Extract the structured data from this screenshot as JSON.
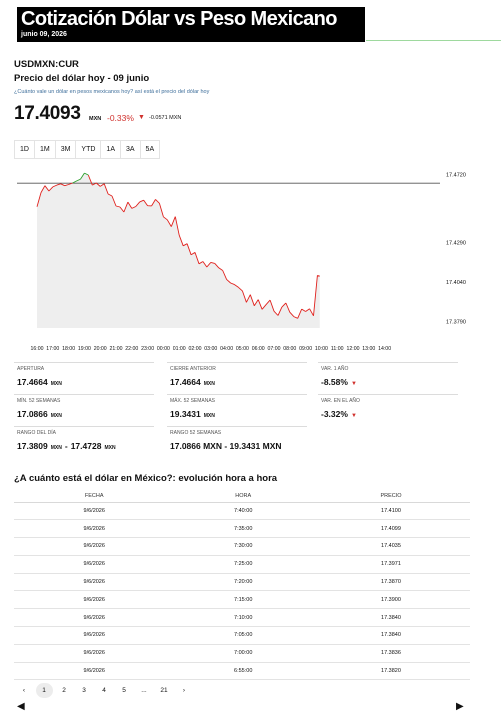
{
  "header": {
    "title": "Cotización Dólar vs Peso Mexicano",
    "date": "junio 09, 2026"
  },
  "quote": {
    "ticker": "USDMXN:CUR",
    "subtitle": "Precio del dólar hoy - 09 junio",
    "question": "¿Cuánto vale un dólar en pesos mexicanos hoy? así está el precio del dólar hoy",
    "price": "17.4093",
    "unit": "MXN",
    "change_pct": "-0.33%",
    "change_arrow": "▼",
    "change_abs": "-0.0571 MXN"
  },
  "range_tabs": [
    {
      "label": "1D",
      "active": true
    },
    {
      "label": "1M",
      "active": false
    },
    {
      "label": "3M",
      "active": false
    },
    {
      "label": "YTD",
      "active": false
    },
    {
      "label": "1A",
      "active": false
    },
    {
      "label": "3A",
      "active": false
    },
    {
      "label": "5A",
      "active": false
    }
  ],
  "colors": {
    "up": "#2ca02c",
    "down": "#e0211d",
    "reference_line": "#555555",
    "area_fill": "#eeeeee"
  },
  "chart_data": {
    "type": "line",
    "title": "",
    "xlabel": "",
    "ylabel": "",
    "x_ticks": [
      "16:00",
      "17:00",
      "18:00",
      "19:00",
      "20:00",
      "21:00",
      "22:00",
      "23:00",
      "00:00",
      "01:00",
      "02:00",
      "03:00",
      "04:00",
      "05:00",
      "06:00",
      "07:00",
      "08:00",
      "09:00",
      "10:00",
      "11:00",
      "12:00",
      "13:00",
      "14:00"
    ],
    "y_ticks": [
      17.472,
      17.429,
      17.404,
      17.379
    ],
    "ylim": [
      17.375,
      17.476
    ],
    "y_axis_side": "right",
    "reference_value": 17.4664,
    "reference_label": "Cierre anterior",
    "series": [
      {
        "hours_after_1600": [
          0,
          0.25,
          0.5,
          0.75,
          1,
          1.25,
          1.5,
          1.75,
          2,
          2.25,
          2.5,
          2.75,
          3,
          3.25,
          3.5,
          3.75,
          4,
          4.25,
          4.5,
          4.75,
          5,
          5.25,
          5.5,
          5.75,
          6,
          6.25,
          6.5,
          6.75,
          7,
          7.25,
          7.5,
          7.75,
          8,
          8.25,
          8.5,
          8.75,
          9,
          9.25,
          9.5,
          9.75,
          10,
          10.25,
          10.5,
          10.75,
          11,
          11.25,
          11.5,
          11.75,
          12,
          12.25,
          12.5,
          12.75,
          13,
          13.25,
          13.5,
          13.75,
          14,
          14.25,
          14.5,
          14.75,
          15,
          15.25,
          15.5,
          15.75,
          16,
          16.25,
          16.5,
          16.75,
          17,
          17.25,
          17.5,
          17.75,
          17.9
        ],
        "values": [
          17.4515,
          17.4605,
          17.4648,
          17.4615,
          17.4641,
          17.4652,
          17.466,
          17.4648,
          17.4656,
          17.4665,
          17.4678,
          17.469,
          17.4728,
          17.4716,
          17.4652,
          17.4665,
          17.4644,
          17.4661,
          17.4596,
          17.4583,
          17.452,
          17.4514,
          17.4482,
          17.4545,
          17.4505,
          17.4517,
          17.4546,
          17.4557,
          17.4522,
          17.4521,
          17.4562,
          17.4537,
          17.4452,
          17.4433,
          17.439,
          17.4453,
          17.4336,
          17.4269,
          17.4282,
          17.4212,
          17.4227,
          17.4155,
          17.417,
          17.4135,
          17.4164,
          17.4158,
          17.413,
          17.4113,
          17.4057,
          17.4034,
          17.4024,
          17.4006,
          17.3984,
          17.3912,
          17.396,
          17.389,
          17.3929,
          17.3868,
          17.3898,
          17.3926,
          17.3856,
          17.3829,
          17.3882,
          17.3908,
          17.385,
          17.3822,
          17.3811,
          17.3869,
          17.3854,
          17.3871,
          17.3827,
          17.4082,
          17.4077
        ]
      }
    ]
  },
  "stats": {
    "apertura": {
      "label": "APERTURA",
      "value": "17.4664",
      "unit": "MXN"
    },
    "cierre_anterior": {
      "label": "CIERRE ANTERIOR",
      "value": "17.4664",
      "unit": "MXN"
    },
    "var_1_ano": {
      "label": "VAR. 1 AÑO",
      "value": "-8.58%",
      "arrow": "▼"
    },
    "min_52": {
      "label": "MÍN. 52 SEMANAS",
      "value": "17.0866",
      "unit": "MXN"
    },
    "max_52": {
      "label": "MÁX. 52 SEMANAS",
      "value": "19.3431",
      "unit": "MXN"
    },
    "var_ano": {
      "label": "VAR. EN EL AÑO",
      "value": "-3.32%",
      "arrow": "▼"
    },
    "rango_dia": {
      "label": "RANGO DEL DÍA",
      "low": "17.3809",
      "low_unit": "MXN",
      "sep": "-",
      "high": "17.4728",
      "high_unit": "MXN"
    },
    "rango_52": {
      "label": "RANGO 52 SEMANAS",
      "value": "17.0866 MXN - 19.3431 MXN"
    }
  },
  "history": {
    "title": "¿A cuánto está el dólar en México?: evolución hora a hora",
    "columns": [
      "FECHA",
      "HORA",
      "PRECIO"
    ],
    "rows": [
      [
        "9/6/2026",
        "7:40:00",
        "17.4100"
      ],
      [
        "9/6/2026",
        "7:35:00",
        "17.4099"
      ],
      [
        "9/6/2026",
        "7:30:00",
        "17.4035"
      ],
      [
        "9/6/2026",
        "7:25:00",
        "17.3971"
      ],
      [
        "9/6/2026",
        "7:20:00",
        "17.3870"
      ],
      [
        "9/6/2026",
        "7:15:00",
        "17.3900"
      ],
      [
        "9/6/2026",
        "7:10:00",
        "17.3840"
      ],
      [
        "9/6/2026",
        "7:05:00",
        "17.3840"
      ],
      [
        "9/6/2026",
        "7:00:00",
        "17.3836"
      ],
      [
        "9/6/2026",
        "6:55:00",
        "17.3820"
      ]
    ]
  },
  "pagination": {
    "prev": "‹",
    "pages": [
      "1",
      "2",
      "3",
      "4",
      "5",
      "...",
      "21"
    ],
    "current": "1",
    "next": "›"
  },
  "bottom_nav": {
    "left": "◀",
    "right": "▶"
  }
}
